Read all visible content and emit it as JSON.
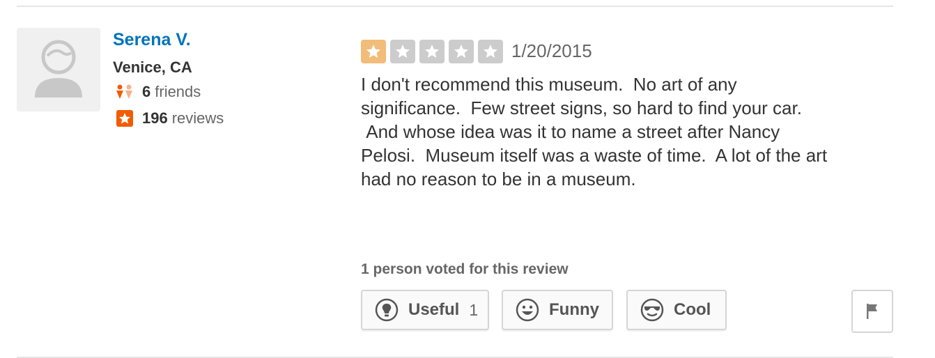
{
  "user": {
    "name": "Serena V.",
    "location": "Venice, CA",
    "friends_count": "6",
    "friends_label": "friends",
    "reviews_count": "196",
    "reviews_label": "reviews"
  },
  "review": {
    "rating": 1,
    "rating_max": 5,
    "date": "1/20/2015",
    "text": "I don't recommend this museum.  No art of any\nsignificance.  Few street signs, so hard to find your car.\n And whose idea was it to name a street after Nancy\nPelosi.  Museum itself was a waste of time.  A lot of the art\nhad no reason to be in a museum."
  },
  "votes": {
    "summary": "1 person voted for this review",
    "useful_label": "Useful",
    "useful_count": "1",
    "funny_label": "Funny",
    "cool_label": "Cool"
  },
  "icons": {
    "avatar": "default-avatar-icon",
    "friends": "friends-icon",
    "reviews": "star-badge-icon",
    "useful": "lightbulb-icon",
    "funny": "smiley-icon",
    "cool": "sunglasses-icon",
    "flag": "flag-icon"
  },
  "colors": {
    "name_link": "#0073bb",
    "star_filled": "#f2bd79",
    "star_empty": "#cccccc",
    "accent_orange": "#f15c00"
  }
}
